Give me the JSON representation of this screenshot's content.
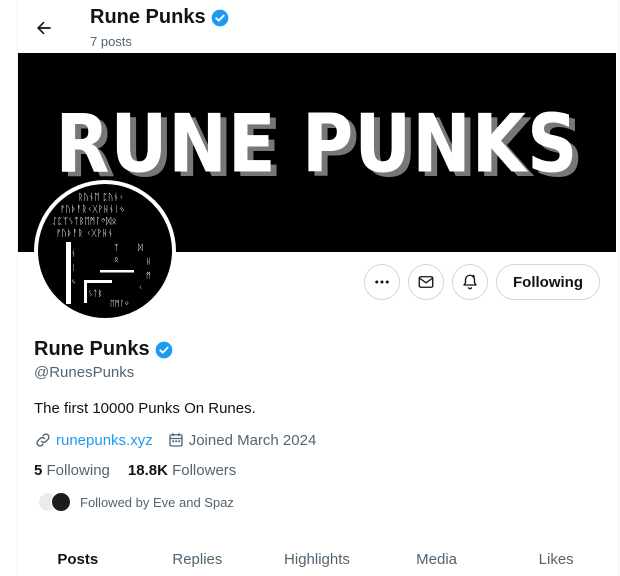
{
  "header": {
    "title": "Rune Punks",
    "post_count": "7 posts"
  },
  "banner": {
    "text": "RUNE PUNKS"
  },
  "actions": {
    "follow_label": "Following"
  },
  "profile": {
    "name": "Rune Punks",
    "handle": "@RunesPunks",
    "bio": "The first 10000 Punks On Runes.",
    "website": "runepunks.xyz",
    "joined": "Joined March 2024",
    "following_count": "5",
    "following_label": "Following",
    "followers_count": "18.8K",
    "followers_label": "Followers",
    "followed_by": "Followed by Eve and Spaz"
  },
  "tabs": [
    "Posts",
    "Replies",
    "Highlights",
    "Media",
    "Likes"
  ],
  "colors": {
    "accent": "#1d9bf0",
    "text": "#0f1419",
    "secondary": "#536471",
    "banner": "#000000"
  },
  "icons": [
    "back-arrow-icon",
    "verified-badge-icon",
    "more-icon",
    "message-icon",
    "notification-bell-icon",
    "link-icon",
    "calendar-icon"
  ]
}
